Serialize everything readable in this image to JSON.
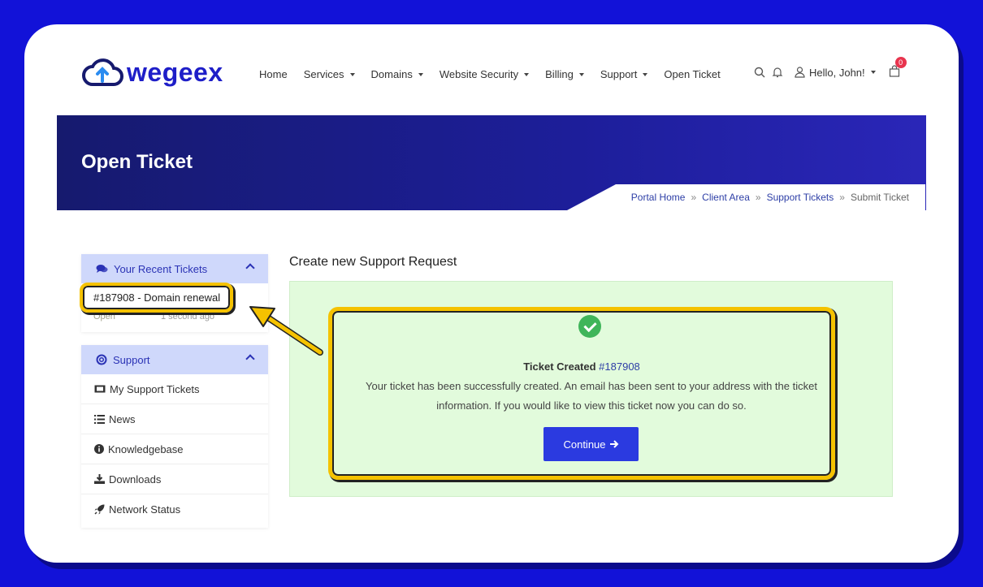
{
  "brand": {
    "name": "wegeex"
  },
  "nav": {
    "items": [
      {
        "label": "Home",
        "dropdown": false
      },
      {
        "label": "Services",
        "dropdown": true
      },
      {
        "label": "Domains",
        "dropdown": true
      },
      {
        "label": "Website Security",
        "dropdown": true
      },
      {
        "label": "Billing",
        "dropdown": true
      },
      {
        "label": "Support",
        "dropdown": true
      },
      {
        "label": "Open Ticket",
        "dropdown": false
      }
    ],
    "greeting": "Hello, John!",
    "cart_count": "0",
    "icons": [
      "search-icon",
      "bell-icon",
      "user-icon",
      "cart-icon"
    ]
  },
  "banner": {
    "title": "Open Ticket",
    "breadcrumb": [
      "Portal Home",
      "Client Area",
      "Support Tickets",
      "Submit Ticket"
    ]
  },
  "sidebar": {
    "recent": {
      "title": "Your Recent Tickets",
      "ticket": {
        "title": "#187908 - Domain renewal",
        "status": "Open",
        "time": "1 second ago"
      }
    },
    "support": {
      "title": "Support",
      "items": [
        {
          "label": "My Support Tickets",
          "icon": "ticket-icon"
        },
        {
          "label": "News",
          "icon": "list-icon"
        },
        {
          "label": "Knowledgebase",
          "icon": "info-icon"
        },
        {
          "label": "Downloads",
          "icon": "download-icon"
        },
        {
          "label": "Network Status",
          "icon": "rocket-icon"
        }
      ]
    }
  },
  "main": {
    "title": "Create new Support Request",
    "success": {
      "heading": "Ticket Created",
      "ticket_id": "#187908",
      "message": "Your ticket has been successfully created. An email has been sent to your address with the ticket information. If you would like to view this ticket now you can do so.",
      "button": "Continue"
    }
  },
  "colors": {
    "accent": "#2b3ae0",
    "banner": "#1d1e9a",
    "highlight": "#f5c200",
    "success_bg": "#e2fbdc",
    "frame": "#1212d8"
  }
}
